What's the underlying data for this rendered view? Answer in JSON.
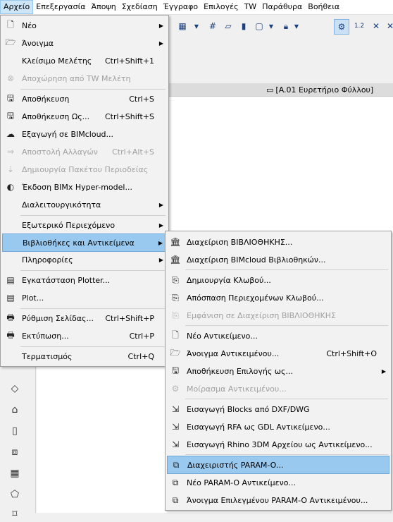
{
  "menubar": {
    "items": [
      "Αρχείο",
      "Επεξεργασία",
      "Άποψη",
      "Σχεδίαση",
      "Έγγραφο",
      "Επιλογές",
      "TW",
      "Παράθυρα",
      "Βοήθεια"
    ]
  },
  "sheet_label": "[A.01 Ευρετήριο Φύλλου]",
  "file_menu": {
    "items": [
      {
        "label": "Νέο",
        "shortcut": "",
        "submenu": true,
        "disabled": false,
        "icon": "new-document-icon"
      },
      {
        "label": "Άνοιγμα",
        "shortcut": "",
        "submenu": true,
        "disabled": false,
        "icon": "open-folder-icon"
      },
      {
        "label": "Κλείσιμο Μελέτης",
        "shortcut": "Ctrl+Shift+1",
        "submenu": false,
        "disabled": false,
        "icon": ""
      },
      {
        "label": "Αποχώρηση από TW Μελέτη",
        "shortcut": "",
        "submenu": false,
        "disabled": true,
        "icon": "teamwork-leave-icon"
      },
      {
        "label": "Αποθήκευση",
        "shortcut": "Ctrl+S",
        "submenu": false,
        "disabled": false,
        "icon": "save-icon"
      },
      {
        "label": "Αποθήκευση Ως...",
        "shortcut": "Ctrl+Shift+S",
        "submenu": false,
        "disabled": false,
        "icon": "save-as-icon"
      },
      {
        "label": "Εξαγωγή σε BIMcloud...",
        "shortcut": "",
        "submenu": false,
        "disabled": false,
        "icon": "bimcloud-export-icon"
      },
      {
        "label": "Αποστολή Αλλαγών",
        "shortcut": "Ctrl+Alt+S",
        "submenu": false,
        "disabled": true,
        "icon": "send-changes-icon"
      },
      {
        "label": "Δημιουργία Πακέτου Περιοδείας",
        "shortcut": "",
        "submenu": false,
        "disabled": true,
        "icon": "travel-pack-icon"
      },
      {
        "label": "Έκδοση BIMx Hyper-model...",
        "shortcut": "",
        "submenu": false,
        "disabled": false,
        "icon": "bimx-icon"
      },
      {
        "label": "Διαλειτουργικότητα",
        "shortcut": "",
        "submenu": true,
        "disabled": false,
        "icon": ""
      },
      {
        "label": "Εξωτερικό Περιεχόμενο",
        "shortcut": "",
        "submenu": true,
        "disabled": false,
        "icon": ""
      },
      {
        "label": "Βιβλιοθήκες και Αντικείμενα",
        "shortcut": "",
        "submenu": true,
        "disabled": false,
        "icon": ""
      },
      {
        "label": "Πληροφορίες",
        "shortcut": "",
        "submenu": true,
        "disabled": false,
        "icon": ""
      },
      {
        "label": "Εγκατάσταση Plotter...",
        "shortcut": "",
        "submenu": false,
        "disabled": false,
        "icon": "plotter-setup-icon"
      },
      {
        "label": "Plot...",
        "shortcut": "",
        "submenu": false,
        "disabled": false,
        "icon": "plot-icon"
      },
      {
        "label": "Ρύθμιση Σελίδας...",
        "shortcut": "Ctrl+Shift+P",
        "submenu": false,
        "disabled": false,
        "icon": "page-setup-icon"
      },
      {
        "label": "Εκτύπωση...",
        "shortcut": "Ctrl+P",
        "submenu": false,
        "disabled": false,
        "icon": "print-icon"
      },
      {
        "label": "Τερματισμός",
        "shortcut": "Ctrl+Q",
        "submenu": false,
        "disabled": false,
        "icon": ""
      }
    ]
  },
  "library_menu": {
    "items": [
      {
        "label": "Διαχείριση ΒΙΒΛΙΟΘΗΚΗΣ...",
        "shortcut": "",
        "submenu": false,
        "disabled": false,
        "icon": "library-manager-icon"
      },
      {
        "label": "Διαχείριση BIMcloud Βιβλιοθηκών...",
        "shortcut": "",
        "submenu": false,
        "disabled": false,
        "icon": "bimcloud-library-icon"
      },
      {
        "label": "Δημιουργία Κλωβού...",
        "shortcut": "",
        "submenu": false,
        "disabled": false,
        "icon": "create-hotlink-icon"
      },
      {
        "label": "Απόσπαση Περιεχομένων Κλωβού...",
        "shortcut": "",
        "submenu": false,
        "disabled": false,
        "icon": "extract-hotlink-icon"
      },
      {
        "label": "Εμφάνιση σε Διαχείριση ΒΙΒΛΙΟΘΗΚΗΣ",
        "shortcut": "",
        "submenu": false,
        "disabled": true,
        "icon": "show-in-library-icon"
      },
      {
        "label": "Νέο Αντικείμενο...",
        "shortcut": "",
        "submenu": false,
        "disabled": false,
        "icon": "new-object-icon"
      },
      {
        "label": "Άνοιγμα Αντικειμένου...",
        "shortcut": "Ctrl+Shift+O",
        "submenu": false,
        "disabled": false,
        "icon": "open-object-icon"
      },
      {
        "label": "Αποθήκευση Επιλογής ως...",
        "shortcut": "",
        "submenu": true,
        "disabled": false,
        "icon": "save-selection-icon"
      },
      {
        "label": "Μοίρασμα Αντικειμένου...",
        "shortcut": "",
        "submenu": false,
        "disabled": true,
        "icon": "share-object-icon"
      },
      {
        "label": "Εισαγωγή Blocks από DXF/DWG",
        "shortcut": "",
        "submenu": false,
        "disabled": false,
        "icon": "import-dxf-icon"
      },
      {
        "label": "Εισαγωγή RFA ως GDL Αντικείμενο...",
        "shortcut": "",
        "submenu": false,
        "disabled": false,
        "icon": "import-rfa-icon"
      },
      {
        "label": "Εισαγωγή Rhino 3DM Αρχείου ως Αντικείμενο...",
        "shortcut": "",
        "submenu": false,
        "disabled": false,
        "icon": "import-rhino-icon"
      },
      {
        "label": "Διαχειριστής PARAM-O...",
        "shortcut": "",
        "submenu": false,
        "disabled": false,
        "icon": "param-o-manager-icon"
      },
      {
        "label": "Νέο PARAM-O Αντικείμενο...",
        "shortcut": "",
        "submenu": false,
        "disabled": false,
        "icon": "new-param-o-icon"
      },
      {
        "label": "Άνοιγμα Επιλεγμένου PARAM-O Αντικειμένου...",
        "shortcut": "",
        "submenu": false,
        "disabled": false,
        "icon": "open-param-o-icon"
      }
    ]
  }
}
